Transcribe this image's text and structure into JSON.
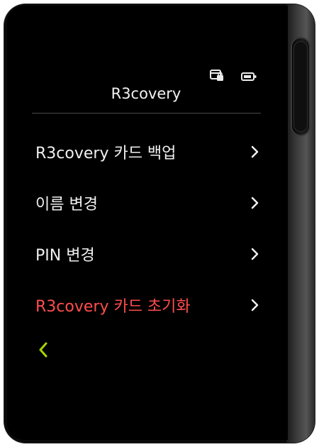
{
  "header": {
    "title": "R3covery",
    "status_icons": [
      "card-lock-icon",
      "battery-icon"
    ]
  },
  "menu": {
    "items": [
      {
        "label": "R3covery 카드 백업"
      },
      {
        "label": "이름 변경"
      },
      {
        "label": "PIN 변경"
      },
      {
        "label": "R3covery 카드 초기화"
      }
    ]
  },
  "colors": {
    "danger": "#ff4d4d",
    "accent": "#a8d400",
    "text": "#f0f0f0"
  },
  "nav": {
    "back_icon": "chevron-left-icon"
  }
}
